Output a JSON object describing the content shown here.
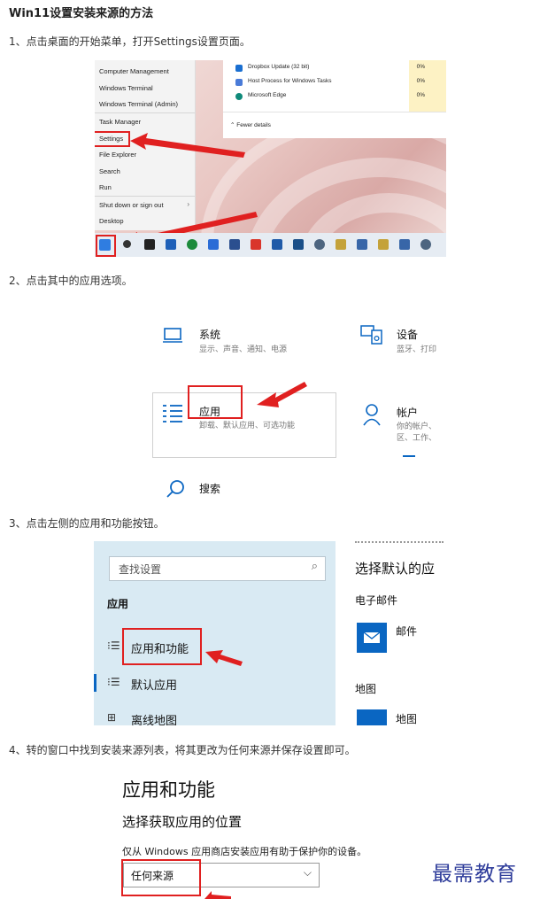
{
  "article": {
    "title": "Win11设置安装来源的方法",
    "step1": "1、点击桌面的开始菜单，打开Settings设置页面。",
    "step2": "2、点击其中的应用选项。",
    "step3": "3、点击左侧的应用和功能按钮。",
    "step4": "4、转的窗口中找到安装来源列表，将其更改为任何来源并保存设置即可。"
  },
  "shot1": {
    "menu_items": [
      "Computer Management",
      "Windows Terminal",
      "Windows Terminal (Admin)",
      "Task Manager",
      "Settings",
      "File Explorer",
      "Search",
      "Run",
      "Shut down or sign out",
      "Desktop"
    ],
    "task_rows": [
      {
        "name": "Dropbox Update (32 bit)",
        "pct": "0%",
        "color": "#1a6fd1"
      },
      {
        "name": "Host Process for Windows Tasks",
        "pct": "0%",
        "color": "#4a7bd8"
      },
      {
        "name": "Microsoft Edge",
        "pct": "0%",
        "color": "#0f8a7a"
      }
    ],
    "fewer_details": "Fewer details"
  },
  "shot2": {
    "system": {
      "title": "系统",
      "sub": "显示、声音、通知、电源"
    },
    "devices": {
      "title": "设备",
      "sub": "蓝牙、打印"
    },
    "apps": {
      "title": "应用",
      "sub": "卸载、默认应用、可选功能"
    },
    "accounts": {
      "title": "帐户",
      "sub1": "你的帐户、",
      "sub2": "区、工作、"
    },
    "search": {
      "title": "搜索"
    }
  },
  "shot3": {
    "search_placeholder": "查找设置",
    "section": "应用",
    "nav_apps_features": "应用和功能",
    "nav_default_apps": "默认应用",
    "nav_offline_maps": "离线地图",
    "right_title": "选择默认的应",
    "email_label": "电子邮件",
    "mail_app": "邮件",
    "maps_label": "地图",
    "maps_app": "地图"
  },
  "shot4": {
    "title": "应用和功能",
    "subtitle": "选择获取应用的位置",
    "desc": "仅从 Windows 应用商店安装应用有助于保护你的设备。",
    "selected": "任何来源"
  },
  "watermark": "最需教育",
  "colors": {
    "highlight": "#e02020",
    "accent": "#0a66c2",
    "watermark": "#2d3b9a"
  }
}
